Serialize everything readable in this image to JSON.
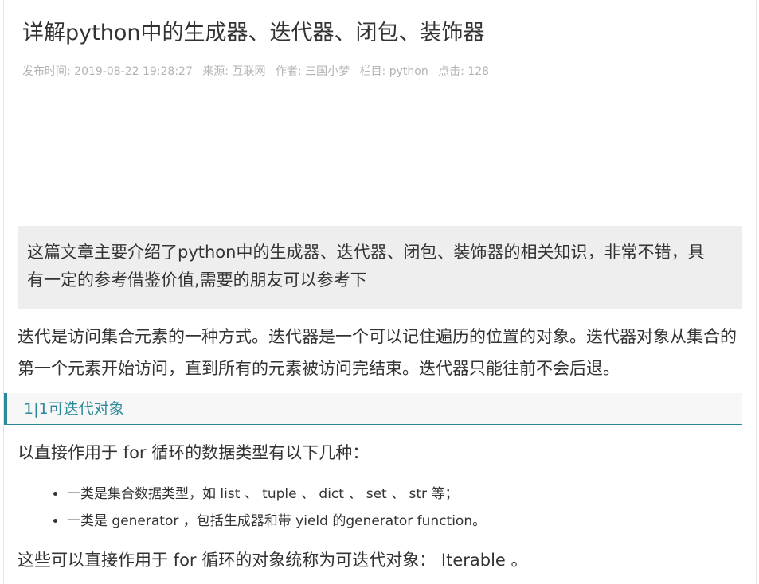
{
  "article": {
    "title": "详解python中的生成器、迭代器、闭包、装饰器",
    "meta": {
      "publish_time": "发布时间: 2019-08-22 19:28:27",
      "source": "来源: 互联网",
      "author": "作者: 三国小梦",
      "column": "栏目: python",
      "clicks": "点击: 128"
    },
    "summary": "这篇文章主要介绍了python中的生成器、迭代器、闭包、装饰器的相关知识，非常不错，具有一定的参考借鉴价值,需要的朋友可以参考下",
    "intro": "迭代是访问集合元素的一种方式。迭代器是一个可以记住遍历的位置的对象。迭代器对象从集合的第一个元素开始访问，直到所有的元素被访问完结束。迭代器只能往前不会后退。",
    "section_heading": "1|1可迭代对象",
    "section_lead": "以直接作用于 for 循环的数据类型有以下几种：",
    "bullets": [
      "一类是集合数据类型，如 list 、 tuple 、 dict 、 set 、 str 等；",
      "一类是 generator ，包括生成器和带 yield 的generator function。"
    ],
    "closing": "这些可以直接作用于 for 循环的对象统称为可迭代对象： Iterable 。"
  }
}
